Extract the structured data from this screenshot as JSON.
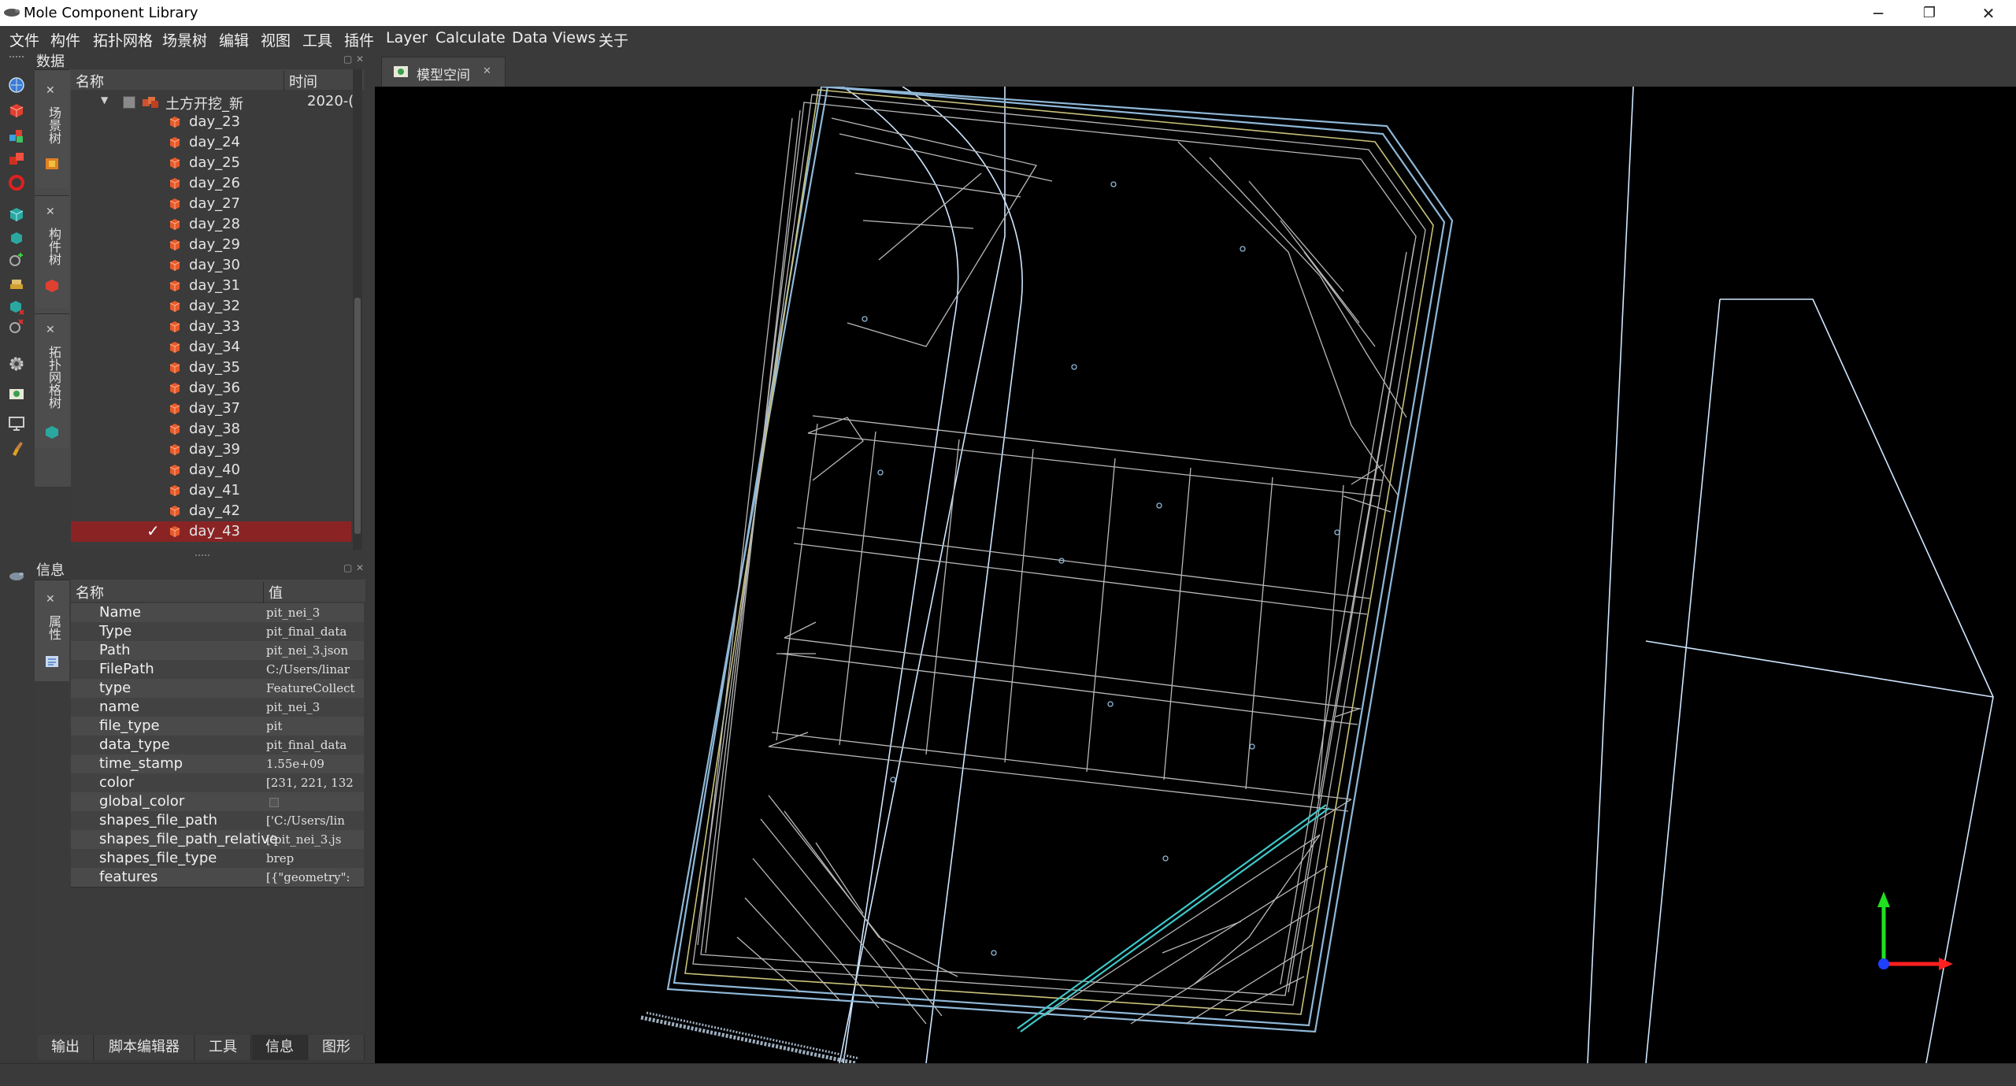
{
  "window": {
    "title": "Mole Component Library",
    "minimize_glyph": "─",
    "restore_glyph": "❐",
    "close_glyph": "✕"
  },
  "menu": [
    "文件",
    "构件",
    "拓扑网格",
    "场景树",
    "编辑",
    "视图",
    "工具",
    "插件",
    "Layer",
    "Calculate",
    "Data Views",
    "关于"
  ],
  "left_toolbar": {
    "icons": [
      "globe-icon",
      "red-cube-icon",
      "multi-cube-icon",
      "red-cubes-icon",
      "red-ring-icon",
      "teal-cube-icon",
      "teal-cube-small-icon",
      "add-node-icon",
      "stack-icon",
      "teal-cube-remove-icon",
      "remove-node-icon",
      "gear-icon",
      "camera-icon",
      "monitor-icon",
      "brush-icon",
      "mole-icon"
    ]
  },
  "data_panel": {
    "title": "数据",
    "side_tabs": [
      "场景树",
      "构件树",
      "拓扑网格树"
    ],
    "columns": [
      "名称",
      "时间"
    ],
    "root": {
      "label": "土方开挖_新",
      "time": "2020-("
    },
    "items": [
      "day_23",
      "day_24",
      "day_25",
      "day_26",
      "day_27",
      "day_28",
      "day_29",
      "day_30",
      "day_31",
      "day_32",
      "day_33",
      "day_34",
      "day_35",
      "day_36",
      "day_37",
      "day_38",
      "day_39",
      "day_40",
      "day_41",
      "day_42",
      "day_43"
    ],
    "selected_item": "day_43",
    "check_glyph": "✓"
  },
  "info_panel": {
    "title": "信息",
    "side_tab": "属性",
    "columns": [
      "名称",
      "值"
    ],
    "rows": [
      {
        "key": "Name",
        "value": "pit_nei_3"
      },
      {
        "key": "Type",
        "value": "pit_final_data"
      },
      {
        "key": "Path",
        "value": "pit_nei_3.json"
      },
      {
        "key": "FilePath",
        "value": "C:/Users/linar"
      },
      {
        "key": "type",
        "value": "FeatureCollect"
      },
      {
        "key": "name",
        "value": "pit_nei_3"
      },
      {
        "key": "file_type",
        "value": "pit"
      },
      {
        "key": "data_type",
        "value": "pit_final_data"
      },
      {
        "key": "time_stamp",
        "value": "1.55e+09"
      },
      {
        "key": "color",
        "value": "[231, 221, 132"
      },
      {
        "key": "global_color",
        "value": ""
      },
      {
        "key": "shapes_file_path",
        "value": "['C:/Users/lin"
      },
      {
        "key": "shapes_file_path_relative",
        "value": "['pit_nei_3.js"
      },
      {
        "key": "shapes_file_type",
        "value": "brep"
      },
      {
        "key": "features",
        "value": "[{\"geometry\":"
      }
    ]
  },
  "bottom_tabs": [
    "输出",
    "脚本编辑器",
    "工具",
    "信息",
    "图形"
  ],
  "viewport": {
    "tab_label": "模型空间",
    "tab_close_glyph": "✕",
    "background": "#000000",
    "colors": {
      "outer_boundary": "#8fb8d8",
      "wireframe": "#b8b8b8",
      "inner_yellow": "#c8c27a",
      "highlight": "#3fc7c7",
      "road": "#cfe7ff",
      "axis_x": "#ff2020",
      "axis_y": "#20e020",
      "axis_z": "#2040ff"
    }
  }
}
